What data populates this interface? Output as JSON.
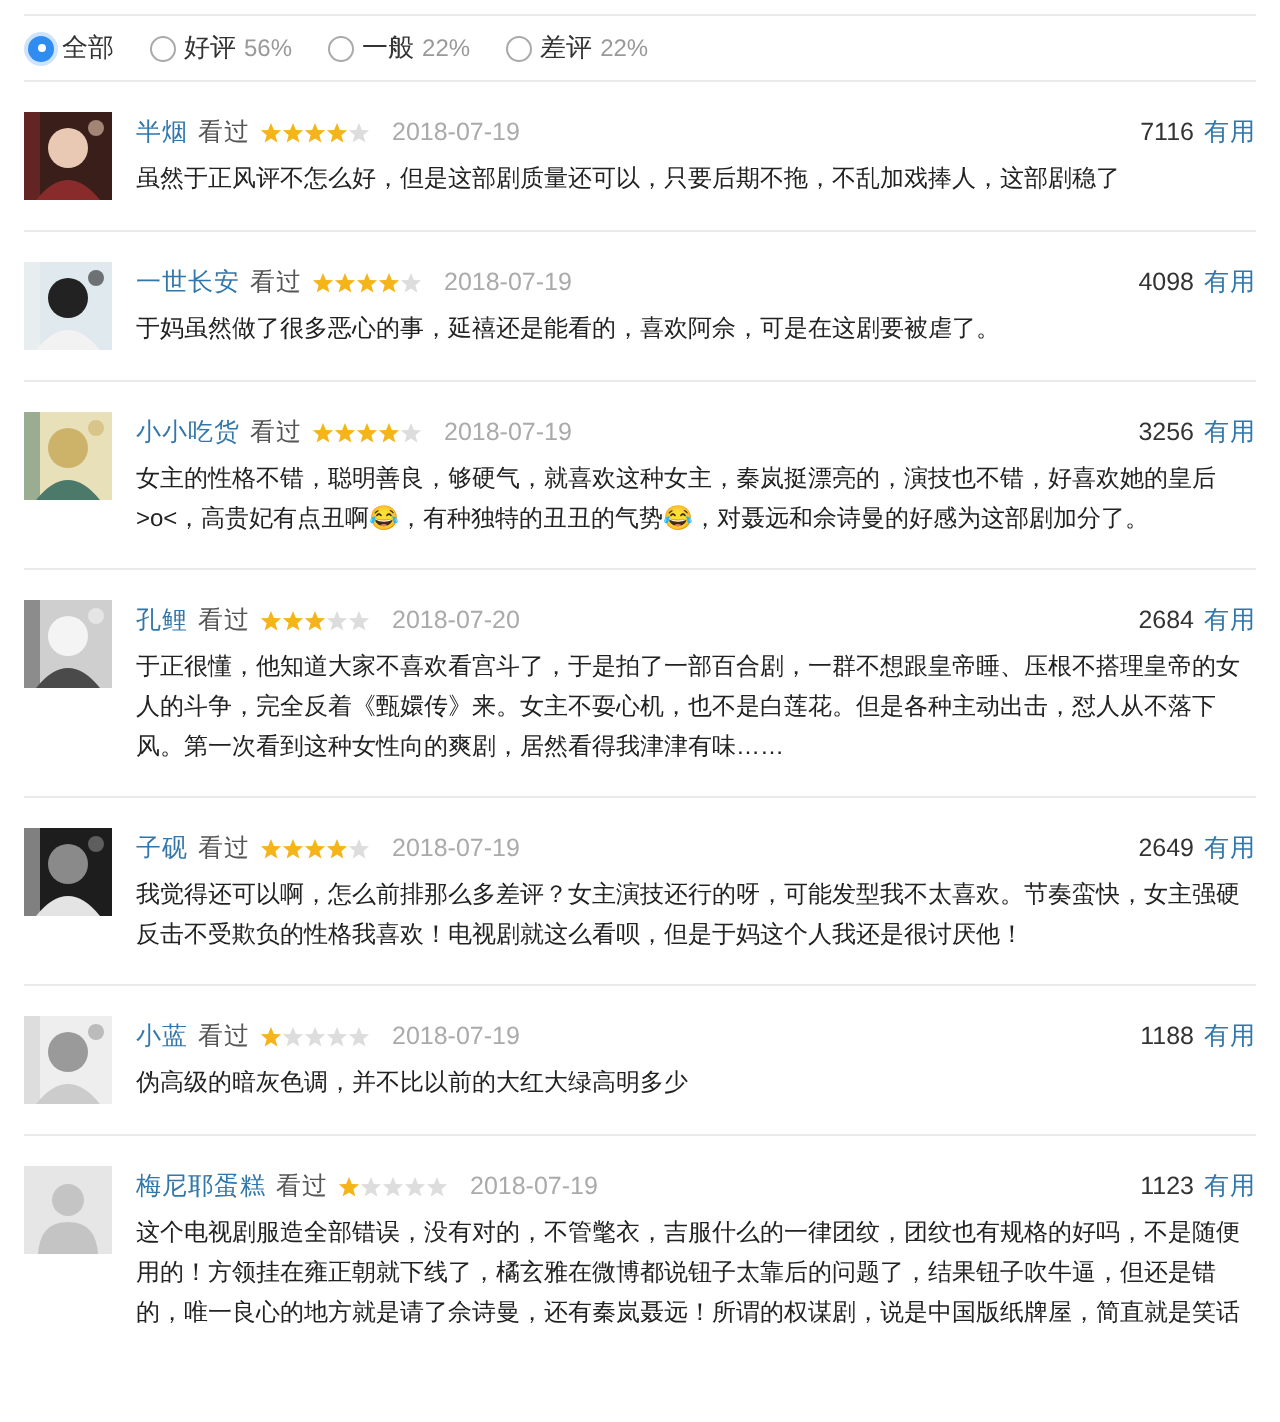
{
  "filters": [
    {
      "label": "全部",
      "selected": true
    },
    {
      "label": "好评",
      "percent": "56%",
      "selected": false
    },
    {
      "label": "一般",
      "percent": "22%",
      "selected": false
    },
    {
      "label": "差评",
      "percent": "22%",
      "selected": false
    }
  ],
  "reviews": [
    {
      "user": "半烟",
      "status": "看过",
      "stars": 4,
      "date": "2018-07-19",
      "votes": "7116",
      "useful": "有用",
      "text": "虽然于正风评不怎么好，但是这部剧质量还可以，只要后期不拖，不乱加戏捧人，这部剧稳了",
      "kind": "picture"
    },
    {
      "user": "一世长安",
      "status": "看过",
      "stars": 4,
      "date": "2018-07-19",
      "votes": "4098",
      "useful": "有用",
      "text": "于妈虽然做了很多恶心的事，延禧还是能看的，喜欢阿佘，可是在这剧要被虐了。",
      "kind": "picture"
    },
    {
      "user": "小小吃货",
      "status": "看过",
      "stars": 4,
      "date": "2018-07-19",
      "votes": "3256",
      "useful": "有用",
      "text": "女主的性格不错，聪明善良，够硬气，就喜欢这种女主，秦岚挺漂亮的，演技也不错，好喜欢她的皇后>o<，高贵妃有点丑啊😂，有种独特的丑丑的气势😂，对聂远和佘诗曼的好感为这部剧加分了。",
      "kind": "picture"
    },
    {
      "user": "孔鲤",
      "status": "看过",
      "stars": 3,
      "date": "2018-07-20",
      "votes": "2684",
      "useful": "有用",
      "text": "于正很懂，他知道大家不喜欢看宫斗了，于是拍了一部百合剧，一群不想跟皇帝睡、压根不搭理皇帝的女人的斗争，完全反着《甄嬛传》来。女主不耍心机，也不是白莲花。但是各种主动出击，怼人从不落下风。第一次看到这种女性向的爽剧，居然看得我津津有味……",
      "kind": "picture"
    },
    {
      "user": "子砚",
      "status": "看过",
      "stars": 4,
      "date": "2018-07-19",
      "votes": "2649",
      "useful": "有用",
      "text": "我觉得还可以啊，怎么前排那么多差评？女主演技还行的呀，可能发型我不太喜欢。节奏蛮快，女主强硬反击不受欺负的性格我喜欢！电视剧就这么看呗，但是于妈这个人我还是很讨厌他！",
      "kind": "picture"
    },
    {
      "user": "小蓝",
      "status": "看过",
      "stars": 1,
      "date": "2018-07-19",
      "votes": "1188",
      "useful": "有用",
      "text": "伪高级的暗灰色调，并不比以前的大红大绿高明多少",
      "kind": "picture"
    },
    {
      "user": "梅尼耶蛋糕",
      "status": "看过",
      "stars": 1,
      "date": "2018-07-19",
      "votes": "1123",
      "useful": "有用",
      "text": "这个电视剧服造全部错误，没有对的，不管氅衣，吉服什么的一律团纹，团纹也有规格的好吗，不是随便用的！方领挂在雍正朝就下线了，橘玄雅在微博都说钮子太靠后的问题了，结果钮子吹牛逼，但还是错的，唯一良心的地方就是请了佘诗曼，还有秦岚聂远！所谓的权谋剧，说是中国版纸牌屋，简直就是笑话",
      "kind": "default"
    }
  ]
}
